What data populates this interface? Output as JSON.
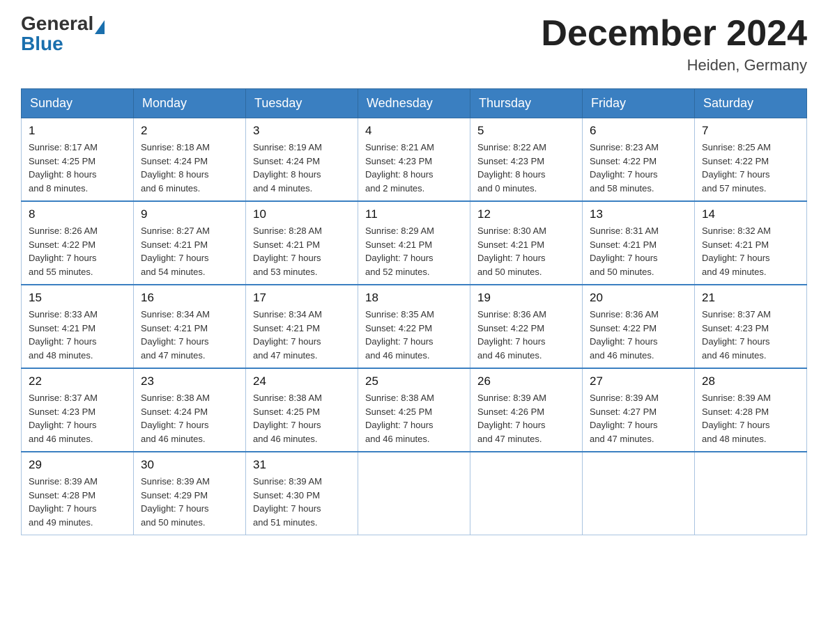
{
  "header": {
    "logo_general": "General",
    "logo_blue": "Blue",
    "month_title": "December 2024",
    "location": "Heiden, Germany"
  },
  "days_of_week": [
    "Sunday",
    "Monday",
    "Tuesday",
    "Wednesday",
    "Thursday",
    "Friday",
    "Saturday"
  ],
  "weeks": [
    [
      {
        "day": "1",
        "sunrise": "8:17 AM",
        "sunset": "4:25 PM",
        "daylight": "8 hours and 8 minutes."
      },
      {
        "day": "2",
        "sunrise": "8:18 AM",
        "sunset": "4:24 PM",
        "daylight": "8 hours and 6 minutes."
      },
      {
        "day": "3",
        "sunrise": "8:19 AM",
        "sunset": "4:24 PM",
        "daylight": "8 hours and 4 minutes."
      },
      {
        "day": "4",
        "sunrise": "8:21 AM",
        "sunset": "4:23 PM",
        "daylight": "8 hours and 2 minutes."
      },
      {
        "day": "5",
        "sunrise": "8:22 AM",
        "sunset": "4:23 PM",
        "daylight": "8 hours and 0 minutes."
      },
      {
        "day": "6",
        "sunrise": "8:23 AM",
        "sunset": "4:22 PM",
        "daylight": "7 hours and 58 minutes."
      },
      {
        "day": "7",
        "sunrise": "8:25 AM",
        "sunset": "4:22 PM",
        "daylight": "7 hours and 57 minutes."
      }
    ],
    [
      {
        "day": "8",
        "sunrise": "8:26 AM",
        "sunset": "4:22 PM",
        "daylight": "7 hours and 55 minutes."
      },
      {
        "day": "9",
        "sunrise": "8:27 AM",
        "sunset": "4:21 PM",
        "daylight": "7 hours and 54 minutes."
      },
      {
        "day": "10",
        "sunrise": "8:28 AM",
        "sunset": "4:21 PM",
        "daylight": "7 hours and 53 minutes."
      },
      {
        "day": "11",
        "sunrise": "8:29 AM",
        "sunset": "4:21 PM",
        "daylight": "7 hours and 52 minutes."
      },
      {
        "day": "12",
        "sunrise": "8:30 AM",
        "sunset": "4:21 PM",
        "daylight": "7 hours and 50 minutes."
      },
      {
        "day": "13",
        "sunrise": "8:31 AM",
        "sunset": "4:21 PM",
        "daylight": "7 hours and 50 minutes."
      },
      {
        "day": "14",
        "sunrise": "8:32 AM",
        "sunset": "4:21 PM",
        "daylight": "7 hours and 49 minutes."
      }
    ],
    [
      {
        "day": "15",
        "sunrise": "8:33 AM",
        "sunset": "4:21 PM",
        "daylight": "7 hours and 48 minutes."
      },
      {
        "day": "16",
        "sunrise": "8:34 AM",
        "sunset": "4:21 PM",
        "daylight": "7 hours and 47 minutes."
      },
      {
        "day": "17",
        "sunrise": "8:34 AM",
        "sunset": "4:21 PM",
        "daylight": "7 hours and 47 minutes."
      },
      {
        "day": "18",
        "sunrise": "8:35 AM",
        "sunset": "4:22 PM",
        "daylight": "7 hours and 46 minutes."
      },
      {
        "day": "19",
        "sunrise": "8:36 AM",
        "sunset": "4:22 PM",
        "daylight": "7 hours and 46 minutes."
      },
      {
        "day": "20",
        "sunrise": "8:36 AM",
        "sunset": "4:22 PM",
        "daylight": "7 hours and 46 minutes."
      },
      {
        "day": "21",
        "sunrise": "8:37 AM",
        "sunset": "4:23 PM",
        "daylight": "7 hours and 46 minutes."
      }
    ],
    [
      {
        "day": "22",
        "sunrise": "8:37 AM",
        "sunset": "4:23 PM",
        "daylight": "7 hours and 46 minutes."
      },
      {
        "day": "23",
        "sunrise": "8:38 AM",
        "sunset": "4:24 PM",
        "daylight": "7 hours and 46 minutes."
      },
      {
        "day": "24",
        "sunrise": "8:38 AM",
        "sunset": "4:25 PM",
        "daylight": "7 hours and 46 minutes."
      },
      {
        "day": "25",
        "sunrise": "8:38 AM",
        "sunset": "4:25 PM",
        "daylight": "7 hours and 46 minutes."
      },
      {
        "day": "26",
        "sunrise": "8:39 AM",
        "sunset": "4:26 PM",
        "daylight": "7 hours and 47 minutes."
      },
      {
        "day": "27",
        "sunrise": "8:39 AM",
        "sunset": "4:27 PM",
        "daylight": "7 hours and 47 minutes."
      },
      {
        "day": "28",
        "sunrise": "8:39 AM",
        "sunset": "4:28 PM",
        "daylight": "7 hours and 48 minutes."
      }
    ],
    [
      {
        "day": "29",
        "sunrise": "8:39 AM",
        "sunset": "4:28 PM",
        "daylight": "7 hours and 49 minutes."
      },
      {
        "day": "30",
        "sunrise": "8:39 AM",
        "sunset": "4:29 PM",
        "daylight": "7 hours and 50 minutes."
      },
      {
        "day": "31",
        "sunrise": "8:39 AM",
        "sunset": "4:30 PM",
        "daylight": "7 hours and 51 minutes."
      },
      null,
      null,
      null,
      null
    ]
  ],
  "labels": {
    "sunrise": "Sunrise:",
    "sunset": "Sunset:",
    "daylight": "Daylight:"
  }
}
